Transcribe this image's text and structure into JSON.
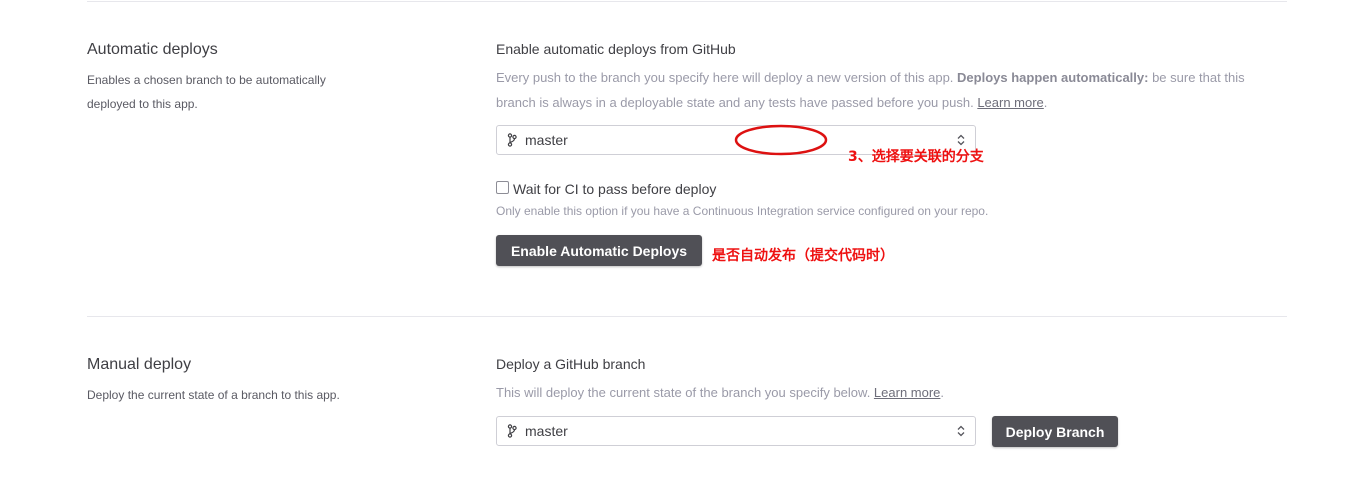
{
  "automatic": {
    "title": "Automatic deploys",
    "description": "Enables a chosen branch to be automatically deployed to this app.",
    "heading": "Enable automatic deploys from GitHub",
    "info_pre": "Every push to the branch you specify here will deploy a new version of this app. ",
    "info_bold": "Deploys happen automatically:",
    "info_post": " be sure that this branch is always in a deployable state and any tests have passed before you push. ",
    "learn_more": "Learn more",
    "period": ".",
    "branch_value": "master",
    "ci_checkbox_label": "Wait for CI to pass before deploy",
    "ci_checked": false,
    "ci_help": "Only enable this option if you have a Continuous Integration service configured on your repo.",
    "enable_button": "Enable Automatic Deploys"
  },
  "manual": {
    "title": "Manual deploy",
    "description": "Deploy the current state of a branch to this app.",
    "heading": "Deploy a GitHub branch",
    "info": "This will deploy the current state of the branch you specify below. ",
    "learn_more": "Learn more",
    "period": ".",
    "branch_value": "master",
    "deploy_button": "Deploy Branch"
  },
  "annotations": {
    "select_branch_note": "3、选择要关联的分支",
    "auto_deploy_note": "是否自动发布（提交代码时）",
    "color": "#ee1111"
  },
  "icons": {
    "branch": "git-branch-icon",
    "select_arrows": "chevron-up-down-icon"
  },
  "colors": {
    "button_bg": "#505056",
    "divider": "#e7e7ec"
  }
}
